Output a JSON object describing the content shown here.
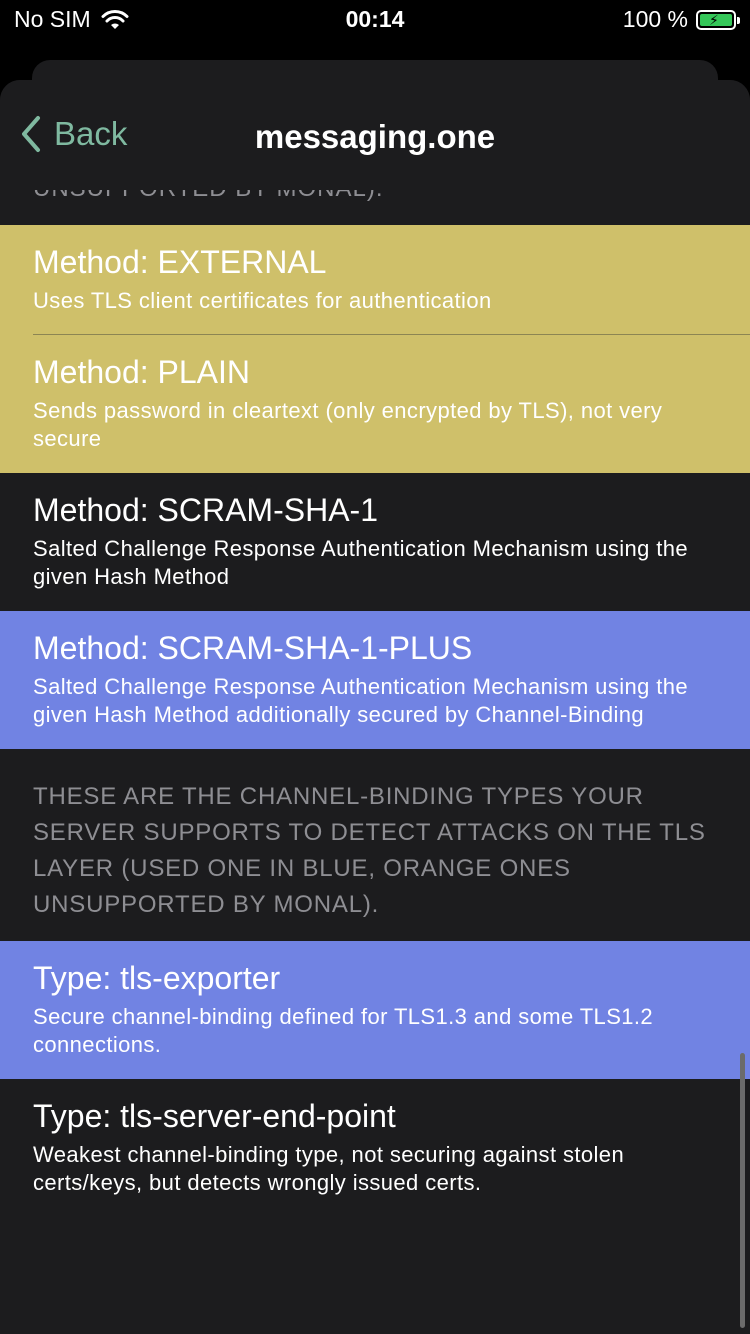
{
  "status": {
    "carrier": "No SIM",
    "time": "00:14",
    "battery": "100 %"
  },
  "nav": {
    "back_label": "Back",
    "title": "messaging.one"
  },
  "cut_header": "UNSUPPORTED BY MONAL).",
  "methods": [
    {
      "title": "Method: EXTERNAL",
      "desc": "Uses TLS client certificates for authentication",
      "color": "#cfc06a"
    },
    {
      "title": "Method: PLAIN",
      "desc": "Sends password in cleartext (only encrypted by TLS), not very secure",
      "color": "#cfc06a"
    },
    {
      "title": "Method: SCRAM-SHA-1",
      "desc": "Salted Challenge Response Authentication Mechanism using the given Hash Method",
      "color": "#1c1c1e"
    },
    {
      "title": "Method: SCRAM-SHA-1-PLUS",
      "desc": "Salted Challenge Response Authentication Mechanism using the given Hash Method additionally secured by Channel-Binding",
      "color": "#7183e3"
    }
  ],
  "channel_binding_header": "THESE ARE THE CHANNEL-BINDING TYPES YOUR SERVER SUPPORTS TO DETECT ATTACKS ON THE TLS LAYER (USED ONE IN BLUE, ORANGE ONES UNSUPPORTED BY MONAL).",
  "types": [
    {
      "title": "Type: tls-exporter",
      "desc": "Secure channel-binding defined for TLS1.3 and some TLS1.2 connections.",
      "color": "#7183e3"
    },
    {
      "title": "Type: tls-server-end-point",
      "desc": "Weakest channel-binding type, not securing against stolen certs/keys, but detects wrongly issued certs.",
      "color": "#1c1c1e"
    }
  ]
}
